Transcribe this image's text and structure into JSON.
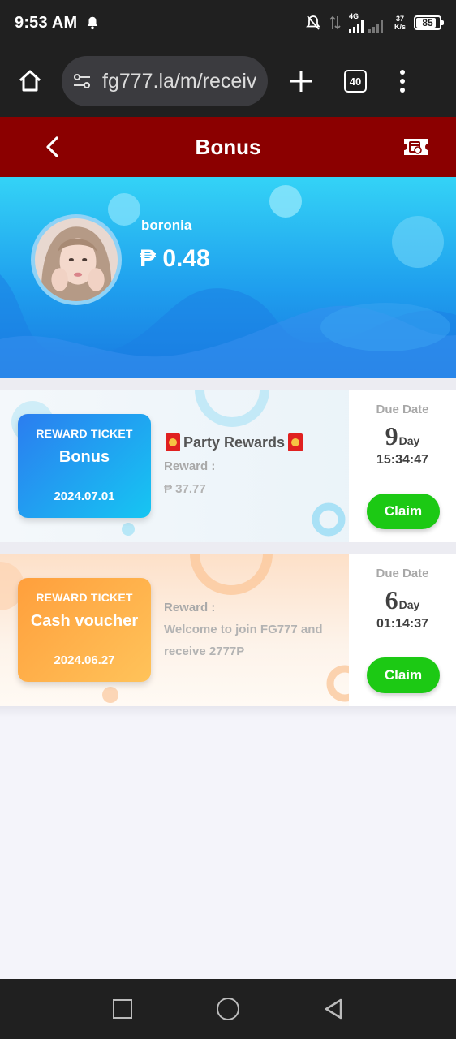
{
  "status_bar": {
    "time": "9:53 AM",
    "network": "4G",
    "speed_value": "37",
    "speed_unit": "K/s",
    "battery": "85"
  },
  "browser": {
    "url": "fg777.la/m/receiv",
    "tab_count": "40"
  },
  "header": {
    "title": "Bonus"
  },
  "profile": {
    "username": "boronia",
    "balance": "₱ 0.48"
  },
  "cards": [
    {
      "ticket_type": "REWARD TICKET",
      "ticket_name": "Bonus",
      "ticket_date": "2024.07.01",
      "promo_title": "Party Rewards",
      "reward_label": "Reward :",
      "reward_value": "₱ 37.77",
      "due_label": "Due Date",
      "due_days": "9",
      "due_unit": "Day",
      "due_time": "15:34:47",
      "button": "Claim"
    },
    {
      "ticket_type": "REWARD TICKET",
      "ticket_name": "Cash voucher",
      "ticket_date": "2024.06.27",
      "reward_label": "Reward :",
      "reward_value": "Welcome to join FG777 and receive 2777P",
      "due_label": "Due Date",
      "due_days": "6",
      "due_unit": "Day",
      "due_time": "01:14:37",
      "button": "Claim"
    }
  ],
  "colors": {
    "header_bg": "#8b0000",
    "claim_bg": "#1cc914",
    "banner_top": "#34d3f6",
    "banner_bottom": "#1878e0"
  }
}
